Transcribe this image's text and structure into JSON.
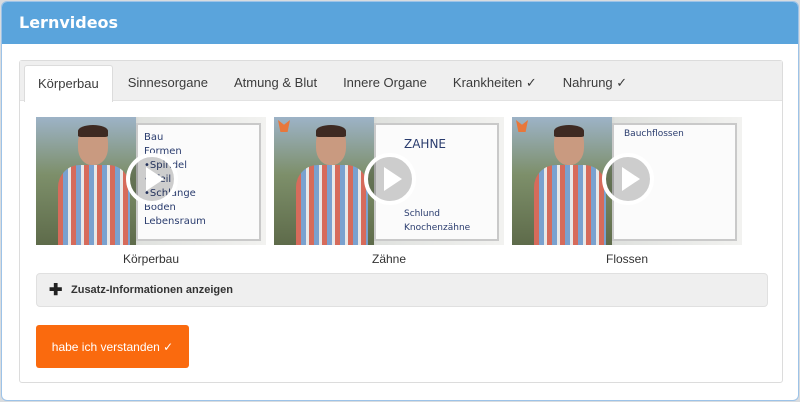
{
  "window": {
    "title": "Lernvideos"
  },
  "tabs": [
    {
      "label": "Körperbau",
      "active": true
    },
    {
      "label": "Sinnesorgane",
      "active": false
    },
    {
      "label": "Atmung & Blut",
      "active": false
    },
    {
      "label": "Innere Organe",
      "active": false
    },
    {
      "label": "Krankheiten ✓",
      "active": false
    },
    {
      "label": "Nahrung ✓",
      "active": false
    }
  ],
  "videos": [
    {
      "caption": "Körperbau",
      "board_text": [
        "Bau",
        "Formen",
        "•Spindel",
        "•Pfeil",
        "•Schlange",
        "Boden",
        "Lebensraum"
      ]
    },
    {
      "caption": "Zähne",
      "board_text": [
        "ZAHNE",
        "Schlund",
        "Knochenzähne"
      ]
    },
    {
      "caption": "Flossen",
      "board_text": [
        "Bauchflossen"
      ]
    }
  ],
  "accordion": {
    "label": "Zusatz-Informationen anzeigen",
    "icon": "plus-icon"
  },
  "confirm_button": {
    "label": "habe ich verstanden ✓"
  },
  "colors": {
    "titlebar": "#5aa4dc",
    "accent": "#fa6a0e"
  }
}
